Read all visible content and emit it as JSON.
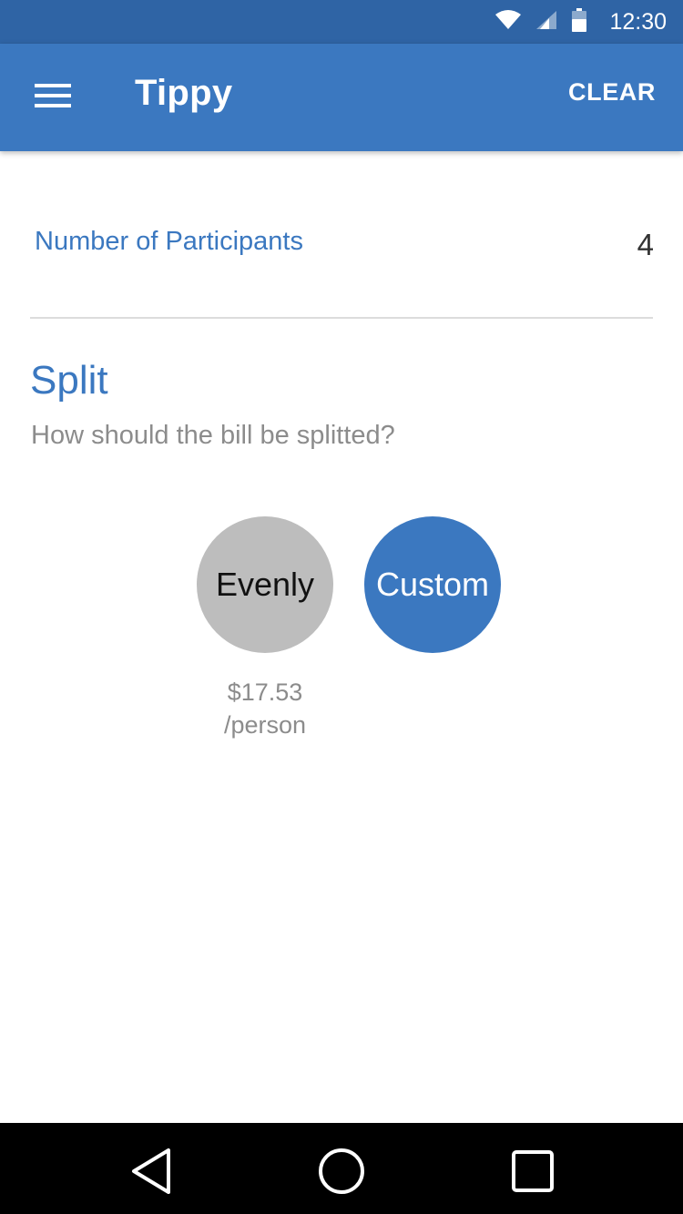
{
  "status_bar": {
    "time": "12:30",
    "icons": [
      "wifi-icon",
      "cell-signal-icon",
      "battery-icon"
    ]
  },
  "app_bar": {
    "title": "Tippy",
    "action_label": "CLEAR",
    "menu_icon": "hamburger-menu-icon"
  },
  "participants": {
    "label": "Number of Participants",
    "value": "4"
  },
  "split": {
    "title": "Split",
    "subtitle": "How should the bill be splitted?",
    "options": [
      {
        "label": "Evenly",
        "selected": false,
        "color": "#bdbdbd"
      },
      {
        "label": "Custom",
        "selected": true,
        "color": "#3b78c0"
      }
    ],
    "per_person_amount": "$17.53",
    "per_person_unit": "/person"
  },
  "nav_bar": {
    "buttons": [
      "back-icon",
      "home-icon",
      "recents-icon"
    ]
  },
  "colors": {
    "primary": "#3b78c0",
    "primary_dark": "#2f64a5",
    "secondary_text": "#8c8c8c"
  }
}
